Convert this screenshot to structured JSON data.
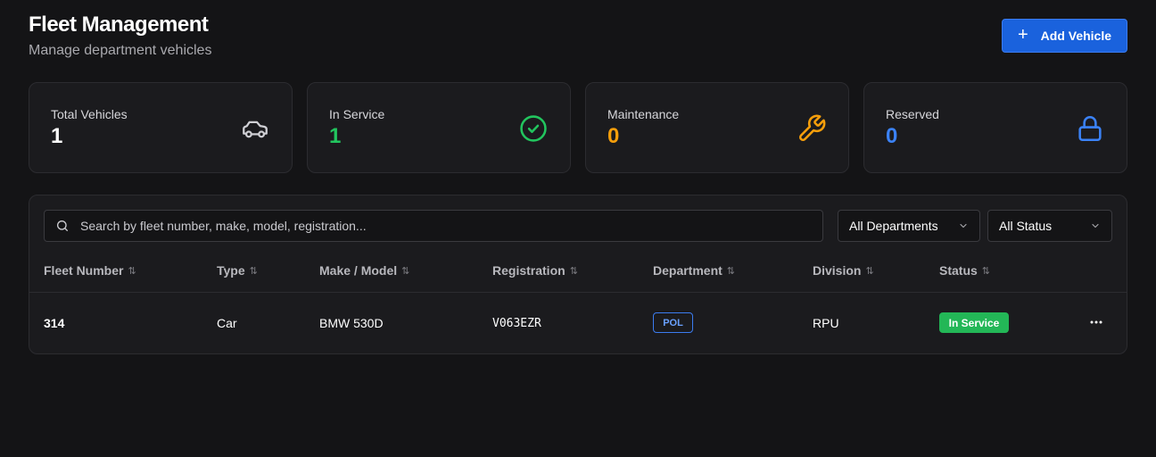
{
  "header": {
    "title": "Fleet Management",
    "subtitle": "Manage department vehicles",
    "add_button_label": "Add Vehicle"
  },
  "stats": [
    {
      "label": "Total Vehicles",
      "value": "1",
      "color": "#ffffff",
      "icon": "car-icon"
    },
    {
      "label": "In Service",
      "value": "1",
      "color": "#22c55e",
      "icon": "check-circle-icon"
    },
    {
      "label": "Maintenance",
      "value": "0",
      "color": "#f59e0b",
      "icon": "wrench-icon"
    },
    {
      "label": "Reserved",
      "value": "0",
      "color": "#3b82f6",
      "icon": "lock-icon"
    }
  ],
  "filters": {
    "search_placeholder": "Search by fleet number, make, model, registration...",
    "department": "All Departments",
    "status": "All Status"
  },
  "table": {
    "columns": [
      "Fleet Number",
      "Type",
      "Make / Model",
      "Registration",
      "Department",
      "Division",
      "Status"
    ],
    "rows": [
      {
        "fleet_number": "314",
        "type": "Car",
        "make_model": "BMW 530D",
        "registration": "V063EZR",
        "department": "POL",
        "division": "RPU",
        "status": "In Service"
      }
    ]
  }
}
